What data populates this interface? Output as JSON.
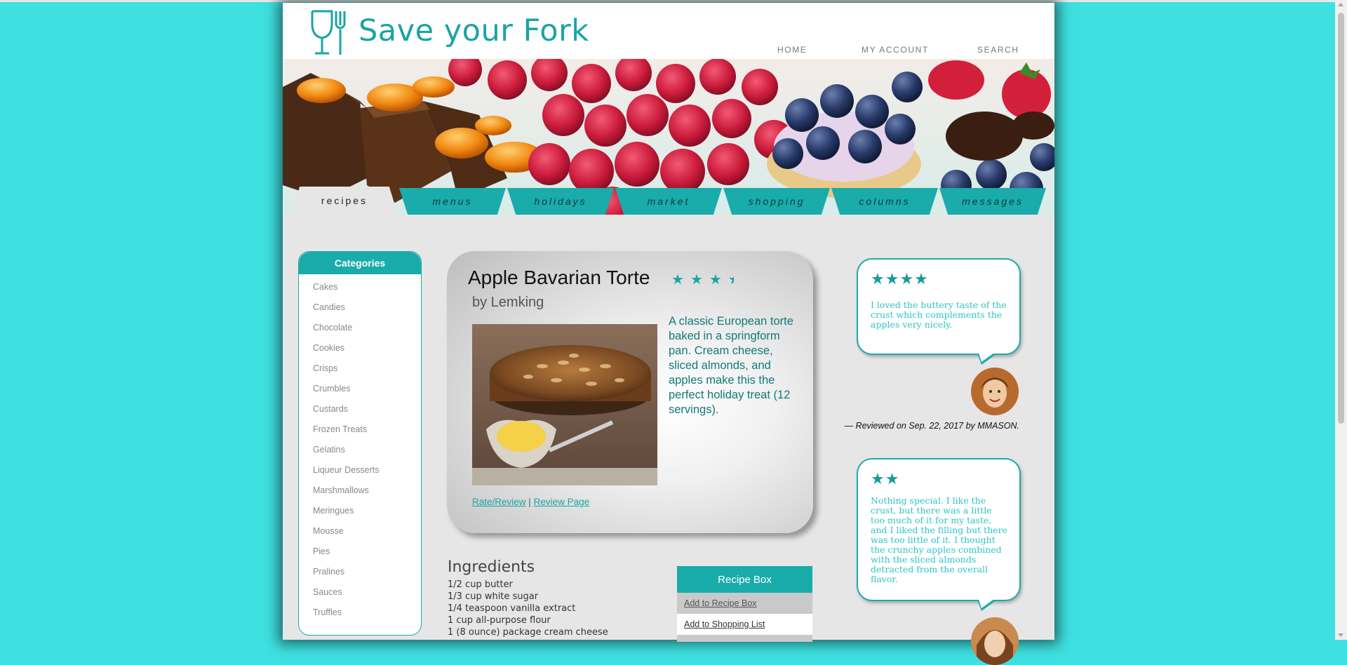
{
  "site": {
    "name": "Save your Fork",
    "colors": {
      "accent": "#1aabab",
      "background": "#3fe0e0",
      "text_teal": "#127a7a"
    }
  },
  "top_nav": [
    "HOME",
    "MY ACCOUNT",
    "SEARCH"
  ],
  "tabs": [
    "recipes",
    "menus",
    "holidays",
    "market",
    "shopping",
    "columns",
    "messages"
  ],
  "active_tab": "recipes",
  "categories": {
    "title": "Categories",
    "items": [
      "Cakes",
      "Candies",
      "Chocolate",
      "Cookies",
      "Crisps",
      "Crumbles",
      "Custards",
      "Frozen Treats",
      "Gelatins",
      "Liqueur Desserts",
      "Marshmallows",
      "Meringues",
      "Mousse",
      "Pies",
      "Pralines",
      "Sauces",
      "Truffles"
    ]
  },
  "recipe": {
    "title": "Apple Bavarian Torte",
    "rating": 3.5,
    "rating_max": 4,
    "author": "by Lemking",
    "description": "A classic European torte baked in a springform pan. Cream cheese, sliced almonds, and apples make this the perfect holiday treat (12 servings).",
    "link_rate": "Rate/Review",
    "link_separator": "|",
    "link_review_page": "Review Page"
  },
  "ingredients": {
    "heading": "Ingredients",
    "items": [
      "1/2 cup butter",
      "1/3 cup white sugar",
      "1/4 teaspoon vanilla extract",
      "1 cup all-purpose flour",
      "1 (8 ounce) package cream cheese"
    ]
  },
  "recipe_box": {
    "heading": "Recipe Box",
    "items": [
      "Add to Recipe Box",
      "Add to Shopping List"
    ]
  },
  "reviews": [
    {
      "stars": "★★★★",
      "text": "I loved the buttery taste of the crust which complements the apples very nicely.",
      "reviewed": "— Reviewed on Sep. 22, 2017 by MMASON."
    },
    {
      "stars": "★★",
      "text": "Nothing special. I like the crust, but there was a little too much of it for my taste, and I liked the filling but there was too little of it. I thought the crunchy apples combined with the sliced almonds detracted from the overall flavor."
    }
  ],
  "icons": {
    "logo": "wine-glass-fork-icon",
    "star": "star-icon"
  }
}
